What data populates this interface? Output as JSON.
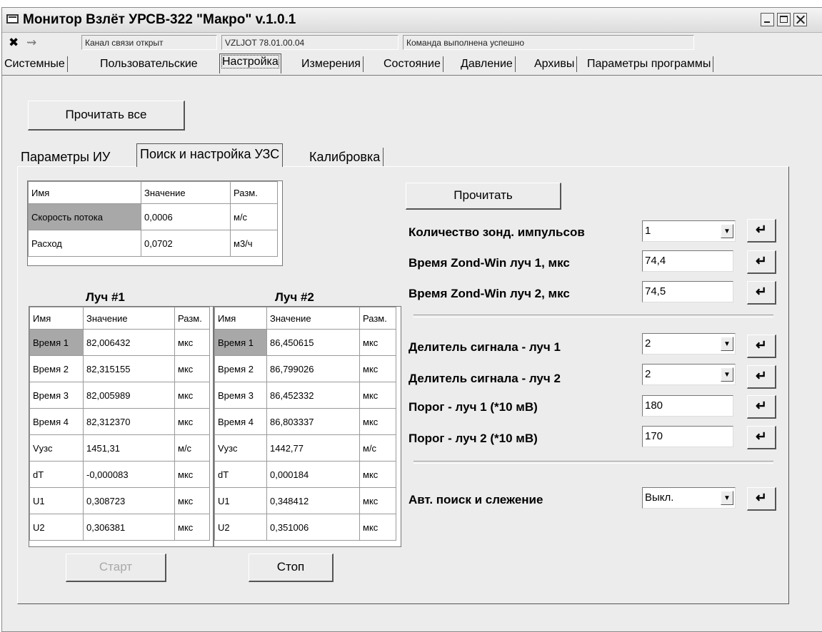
{
  "window": {
    "title": "Монитор Взлёт УРСВ-322 \"Макро\" v.1.0.1"
  },
  "status": {
    "channel": "Канал связи открыт",
    "device": "VZLJOT 78.01.00.04",
    "message": "Команда выполнена успешно",
    "icons": [
      "connect-plug-icon",
      "link-icon"
    ]
  },
  "main_tabs": [
    "Системные",
    "Пользовательские",
    "Настройка",
    "Измерения",
    "Состояние",
    "Давление",
    "Архивы",
    "Параметры программы"
  ],
  "read_all_label": "Прочитать все",
  "sub_tabs": [
    "Параметры ИУ",
    "Поиск и настройка УЗС",
    "Калибровка"
  ],
  "flow_table": {
    "headers": [
      "Имя",
      "Значение",
      "Разм."
    ],
    "rows": [
      [
        "Скорость потока",
        "0,0006",
        "м/с"
      ],
      [
        "Расход",
        "0,0702",
        "м3/ч"
      ]
    ]
  },
  "beam1": {
    "title": "Луч #1",
    "headers": [
      "Имя",
      "Значение",
      "Разм."
    ],
    "rows": [
      [
        "Время 1",
        "82,006432",
        "мкс"
      ],
      [
        "Время 2",
        "82,315155",
        "мкс"
      ],
      [
        "Время 3",
        "82,005989",
        "мкс"
      ],
      [
        "Время 4",
        "82,312370",
        "мкс"
      ],
      [
        "Vузс",
        "1451,31",
        "м/с"
      ],
      [
        "dT",
        "-0,000083",
        "мкс"
      ],
      [
        "U1",
        "0,308723",
        "мкс"
      ],
      [
        "U2",
        "0,306381",
        "мкс"
      ]
    ]
  },
  "beam2": {
    "title": "Луч #2",
    "headers": [
      "Имя",
      "Значение",
      "Разм."
    ],
    "rows": [
      [
        "Время 1",
        "86,450615",
        "мкс"
      ],
      [
        "Время 2",
        "86,799026",
        "мкс"
      ],
      [
        "Время 3",
        "86,452332",
        "мкс"
      ],
      [
        "Время 4",
        "86,803337",
        "мкс"
      ],
      [
        "Vузс",
        "1442,77",
        "м/с"
      ],
      [
        "dT",
        "0,000184",
        "мкс"
      ],
      [
        "U1",
        "0,348412",
        "мкс"
      ],
      [
        "U2",
        "0,351006",
        "мкс"
      ]
    ]
  },
  "start_label": "Старт",
  "stop_label": "Стоп",
  "read_label": "Прочитать",
  "settings": [
    {
      "label": "Количество зонд. импульсов",
      "value": "1",
      "type": "combo"
    },
    {
      "label": "Время Zond-Win луч 1, мкс",
      "value": "74,4",
      "type": "input"
    },
    {
      "label": "Время Zond-Win луч 2, мкс",
      "value": "74,5",
      "type": "input"
    },
    {
      "label": "Делитель сигнала - луч 1",
      "value": "2",
      "type": "combo"
    },
    {
      "label": "Делитель сигнала - луч 2",
      "value": "2",
      "type": "combo"
    },
    {
      "label": "Порог - луч 1 (*10 мВ)",
      "value": "180",
      "type": "input"
    },
    {
      "label": "Порог - луч 2 (*10 мВ)",
      "value": "170",
      "type": "input"
    },
    {
      "label": "Авт. поиск и слежение",
      "value": "Выкл.",
      "type": "combo"
    }
  ],
  "enter_glyph": "↵",
  "dropdown_glyph": "▼"
}
